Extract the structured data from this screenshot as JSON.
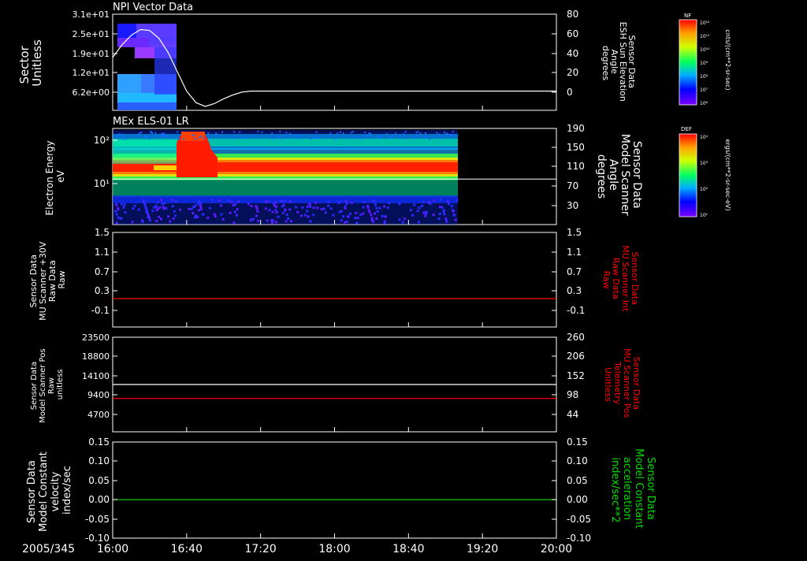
{
  "colors": {
    "background": "#000000",
    "axis": "#ffffff",
    "red": "#ff0000",
    "green": "#00dd00"
  },
  "chart_data": {
    "type": "multi-panel stack plot",
    "date_label": "2005/345",
    "x_axis": {
      "range": [
        "16:00",
        "20:00"
      ],
      "ticks": [
        "16:00",
        "16:40",
        "17:20",
        "18:00",
        "18:40",
        "19:20",
        "20:00"
      ]
    },
    "panels": [
      {
        "title": "NPI Vector Data",
        "left_label": [
          "Sector",
          "Unitless"
        ],
        "left_ticks": [
          "3.1e+01",
          "2.5e+01",
          "1.9e+01",
          "1.2e+01",
          "6.2e+00"
        ],
        "right_label": [
          "Sensor Data",
          "ESH Sun Elevation",
          "Angle",
          "degrees"
        ],
        "right_ticks": [
          "80",
          "60",
          "40",
          "20",
          "0"
        ],
        "right_range": [
          -20,
          80
        ],
        "spectrogram": {
          "x_range": [
            "16:03",
            "16:27"
          ],
          "colormap": "rainbow"
        },
        "line": {
          "color": "#ffffff",
          "x": [
            "16:00",
            "16:05",
            "16:10",
            "16:15",
            "16:20",
            "16:25",
            "16:30",
            "16:35",
            "16:40",
            "16:45",
            "16:50",
            "16:55",
            "17:00",
            "17:05",
            "17:10",
            "17:15",
            "20:00"
          ],
          "y": [
            35,
            48,
            58,
            64,
            63,
            55,
            40,
            20,
            0,
            -12,
            -16,
            -13,
            -8,
            -4,
            -1,
            0,
            0
          ]
        },
        "colorbar": {
          "label": "NF",
          "unit": "cnts/(cm**2-sr-sec)",
          "ticks": [
            "10¹²",
            "10¹¹",
            "10¹⁰",
            "10⁹",
            "10⁸",
            "10⁷",
            "10⁶"
          ]
        }
      },
      {
        "title": "MEx ELS-01 LR",
        "left_label": [
          "Electron Energy",
          "eV"
        ],
        "left_ticks": [
          "10²",
          "10¹"
        ],
        "left_scale": "log",
        "right_label": [
          "Sensor Data",
          "Model Scanner",
          "Angle",
          "degrees"
        ],
        "right_ticks": [
          "190",
          "150",
          "110",
          "70",
          "30"
        ],
        "right_range": [
          0,
          190
        ],
        "spectrogram": {
          "x_range": [
            "16:00",
            "19:00"
          ],
          "colormap": "rainbow"
        },
        "line": {
          "color": "#ffffff",
          "x": [
            "16:00",
            "20:00"
          ],
          "y": [
            90,
            90
          ]
        },
        "colorbar": {
          "label": "DEF",
          "unit": "ergs/(cm**2-sr-sec-eV)",
          "ticks": [
            "10⁴",
            "10³",
            "10²",
            "10¹"
          ]
        }
      },
      {
        "left_label": [
          "Sensor Data",
          "MU Scanner +30V",
          "Raw Data",
          "Raw"
        ],
        "left_ticks": [
          "1.5",
          "1.1",
          "0.7",
          "0.3",
          "-0.1"
        ],
        "left_range": [
          -0.5,
          1.5
        ],
        "right_label": [
          "Sensor Data",
          "MU Scanner Int",
          "Raw Data",
          "Raw"
        ],
        "right_label_color": "#ff0000",
        "right_ticks": [
          "1.5",
          "1.1",
          "0.7",
          "0.3",
          "-0.1"
        ],
        "lines": [
          {
            "color": "#ff0000",
            "x": [
              "16:00",
              "20:00"
            ],
            "y": [
              0.1,
              0.1
            ]
          }
        ]
      },
      {
        "left_label": [
          "Sensor Data",
          "Model Scanner Pos",
          "Raw",
          "unitless"
        ],
        "left_ticks": [
          "23500",
          "18800",
          "14100",
          "9400",
          "4700"
        ],
        "left_range": [
          0,
          23500
        ],
        "right_label": [
          "Sensor Data",
          "MU Scanner Pos",
          "Telemetry",
          "Unitless"
        ],
        "right_label_color": "#ff0000",
        "right_ticks": [
          "260",
          "206",
          "152",
          "98",
          "44"
        ],
        "lines": [
          {
            "color": "#ffffff",
            "x": [
              "16:00",
              "20:00"
            ],
            "y": [
              11750,
              11750
            ]
          },
          {
            "color": "#ff0000",
            "x": [
              "16:00",
              "20:00"
            ],
            "y": [
              8300,
              8300
            ]
          }
        ]
      },
      {
        "left_label": [
          "Sensor Data",
          "Model Constant",
          "velocity",
          "index/sec"
        ],
        "left_ticks": [
          "0.15",
          "0.10",
          "0.05",
          "0.00",
          "-0.05",
          "-0.10"
        ],
        "left_range": [
          -0.1,
          0.15
        ],
        "right_label": [
          "Sensor Data",
          "Model Constant",
          "acceleration",
          "index/sec**2"
        ],
        "right_label_color": "#00dd00",
        "right_ticks": [
          "0.15",
          "0.10",
          "0.05",
          "0.00",
          "-0.05",
          "-0.10"
        ],
        "lines": [
          {
            "color": "#00dd00",
            "x": [
              "16:00",
              "20:00"
            ],
            "y": [
              0.0,
              0.0
            ]
          }
        ]
      }
    ]
  }
}
